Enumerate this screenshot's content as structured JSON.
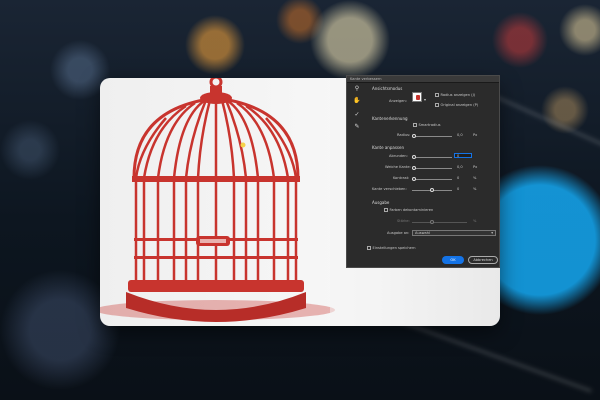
{
  "dialog": {
    "title": "Kante verbessern",
    "view_mode": {
      "heading": "Ansichtsmodus",
      "view_label": "Anzeigen:",
      "show_radius": "Radius anzeigen (J)",
      "show_original": "Original anzeigen (P)"
    },
    "edge_detection": {
      "heading": "Kantenerkennung",
      "smart_radius": "Smartradius",
      "radius_label": "Radius:",
      "radius_value": "0,0",
      "radius_unit": "Px",
      "radius_level": 0
    },
    "adjust_edge": {
      "heading": "Kante anpassen",
      "smooth": {
        "label": "Abrunden:",
        "value": "0",
        "unit": "",
        "level": 0
      },
      "feather": {
        "label": "Weiche Kante:",
        "value": "0,0",
        "unit": "Px",
        "level": 0
      },
      "contrast": {
        "label": "Kontrast:",
        "value": "0",
        "unit": "%",
        "level": 0
      },
      "shift_edge": {
        "label": "Kante verschieben:",
        "value": "0",
        "unit": "%",
        "level": 0.5
      }
    },
    "output": {
      "heading": "Ausgabe",
      "decontaminate": "Farben dekontaminieren",
      "amount_label": "Stärke:",
      "amount_unit": "%",
      "output_to_label": "Ausgabe an:",
      "output_to_value": "Auswahl"
    },
    "remember_settings": "Einstellungen speichern",
    "ok_label": "OK",
    "cancel_label": "Abbrechen"
  },
  "colors": {
    "cage": "#c8342e",
    "accent": "#1473e6"
  }
}
